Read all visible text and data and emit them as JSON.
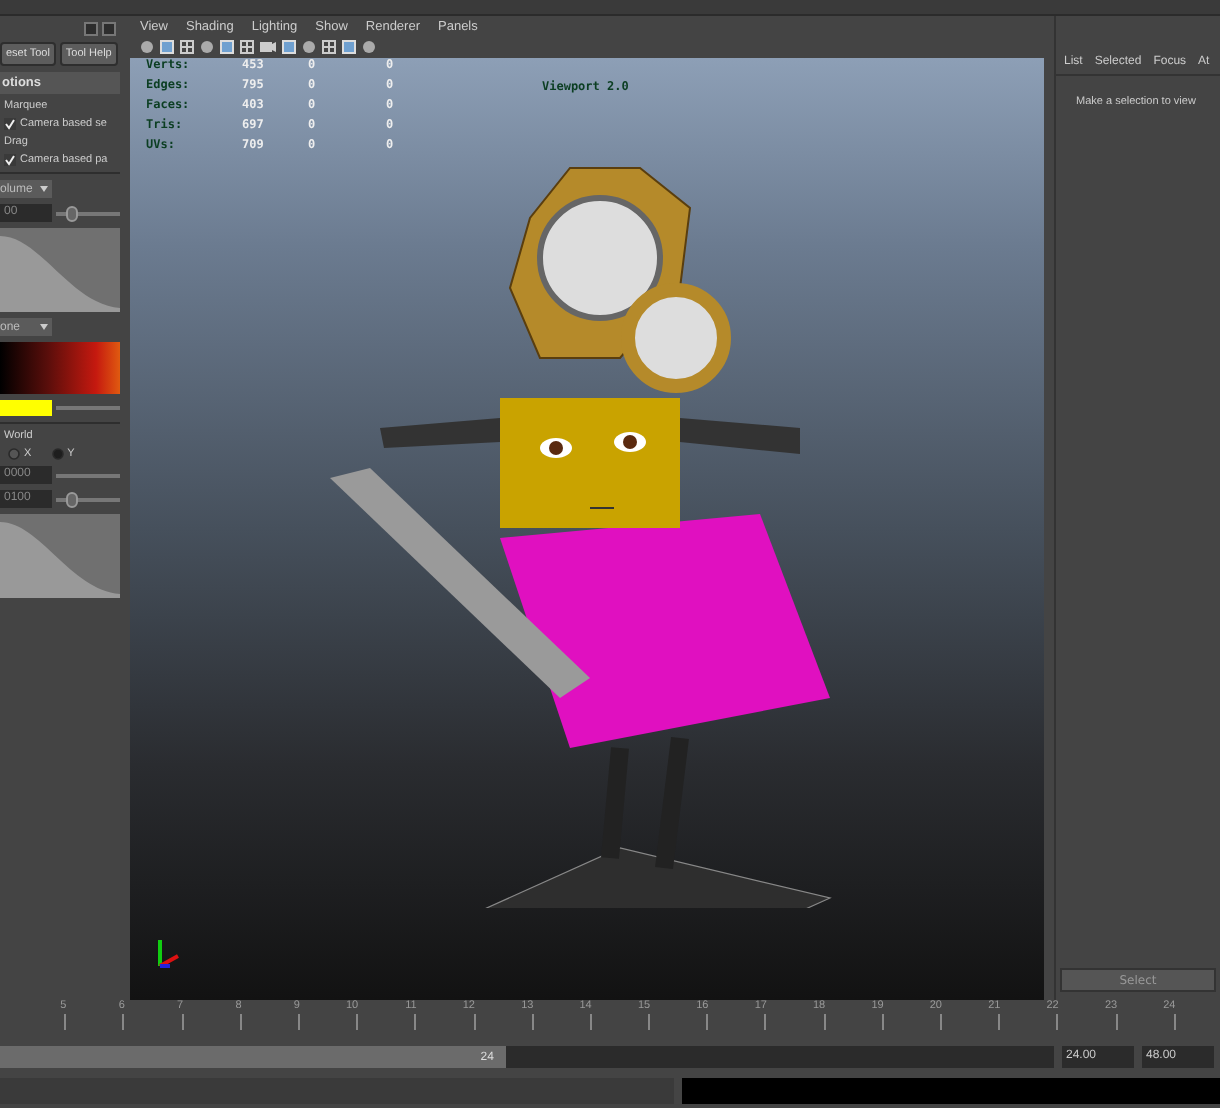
{
  "tool_settings": {
    "buttons": [
      "eset Tool",
      "Tool Help"
    ],
    "section_title": "otions",
    "rows": [
      {
        "kind": "label",
        "text": "Marquee"
      },
      {
        "kind": "check",
        "text": "Camera based se",
        "checked": true
      },
      {
        "kind": "label",
        "text": "Drag"
      },
      {
        "kind": "check",
        "text": "Camera based pa",
        "checked": true
      }
    ],
    "falloff_mode": "olume",
    "radius": {
      "value": "00",
      "level": 0.15
    },
    "interpolation": "one",
    "secondary_label": "World",
    "axes": [
      {
        "label": "X",
        "selected": false
      },
      {
        "label": "Y",
        "selected": true
      }
    ],
    "field_a": "0000",
    "field_b": {
      "value": "0100",
      "level": 0.15
    }
  },
  "viewport": {
    "menus": [
      "View",
      "Shading",
      "Lighting",
      "Show",
      "Renderer",
      "Panels"
    ],
    "hud": [
      {
        "label": "Verts:",
        "values": [
          "453",
          "0",
          "0"
        ]
      },
      {
        "label": "Edges:",
        "values": [
          "795",
          "0",
          "0"
        ]
      },
      {
        "label": "Faces:",
        "values": [
          "403",
          "0",
          "0"
        ]
      },
      {
        "label": "Tris:",
        "values": [
          "697",
          "0",
          "0"
        ]
      },
      {
        "label": "UVs:",
        "values": [
          "709",
          "0",
          "0"
        ]
      }
    ],
    "renderer_label": "Viewport 2.0"
  },
  "attribute_panel": {
    "tabs": [
      "List",
      "Selected",
      "Focus",
      "At"
    ],
    "message": "Make a selection to view",
    "button": "Select"
  },
  "timeline": {
    "ticks": [
      "5",
      "6",
      "7",
      "8",
      "9",
      "10",
      "11",
      "12",
      "13",
      "14",
      "15",
      "16",
      "17",
      "18",
      "19",
      "20",
      "21",
      "22",
      "23",
      "24"
    ],
    "range": {
      "current": "24",
      "level": 0.48,
      "end": "24.00",
      "max": "48.00"
    }
  }
}
